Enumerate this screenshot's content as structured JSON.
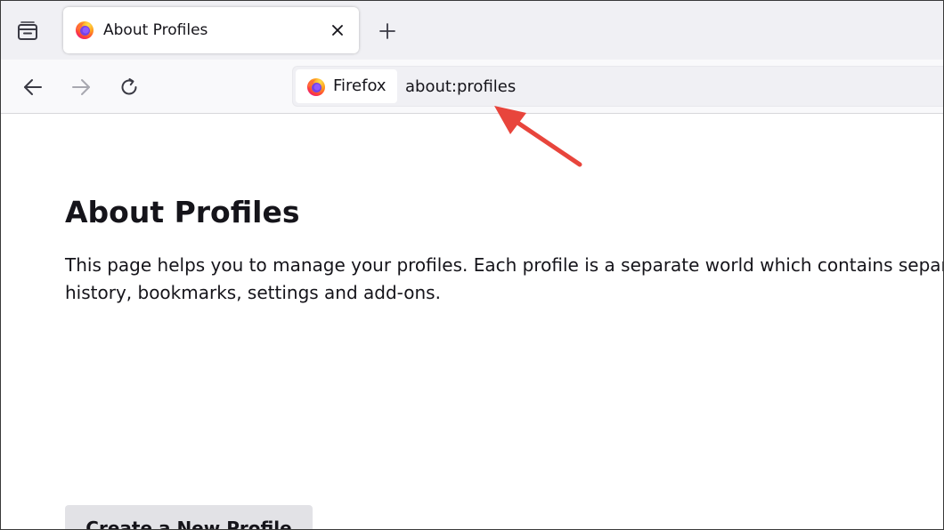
{
  "browser": {
    "tab": {
      "title": "About Profiles",
      "favicon": "firefox-icon"
    },
    "toolbar": {
      "tab_list_icon": "tab-list-icon",
      "new_tab_icon": "plus-icon",
      "back_icon": "back-arrow-icon",
      "forward_icon": "forward-arrow-icon",
      "reload_icon": "reload-icon"
    },
    "urlbar": {
      "identity_label": "Firefox",
      "url": "about:profiles"
    }
  },
  "annotation": {
    "arrow_color": "#e8453c"
  },
  "page": {
    "title": "About Profiles",
    "description": "This page helps you to manage your profiles. Each profile is a separate world which contains separate history, bookmarks, settings and add-ons.",
    "create_button": "Create a New Profile"
  },
  "colors": {
    "tabstrip_bg": "#f0f0f4",
    "navbar_bg": "#f9f9fb",
    "button_bg": "#e2e2e6",
    "text": "#15141a"
  }
}
